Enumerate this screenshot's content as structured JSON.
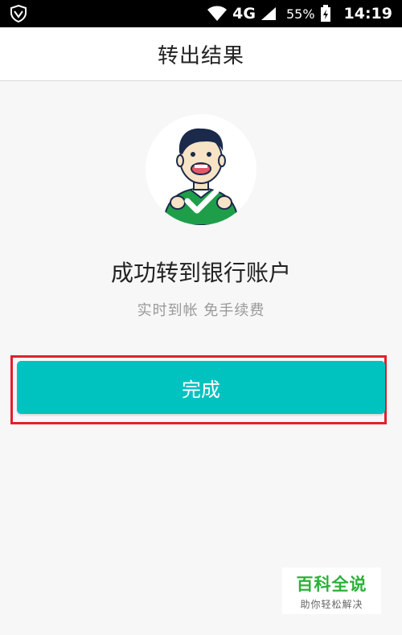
{
  "status_bar": {
    "network": "4G",
    "battery_percent": "55%",
    "time": "14:19",
    "icons": [
      "shield-icon",
      "wifi-icon",
      "signal-icon",
      "battery-charging-icon"
    ]
  },
  "header": {
    "title": "转出结果"
  },
  "result": {
    "illustration": "man-with-checkmark-avatar",
    "message": "成功转到银行账户",
    "subtext": "实时到帐 免手续费"
  },
  "actions": {
    "done_label": "完成",
    "accent_color": "#00c3c0",
    "highlight_color": "#e0212b"
  },
  "watermark": {
    "title": "百科全说",
    "subtitle": "助你轻松解决"
  }
}
